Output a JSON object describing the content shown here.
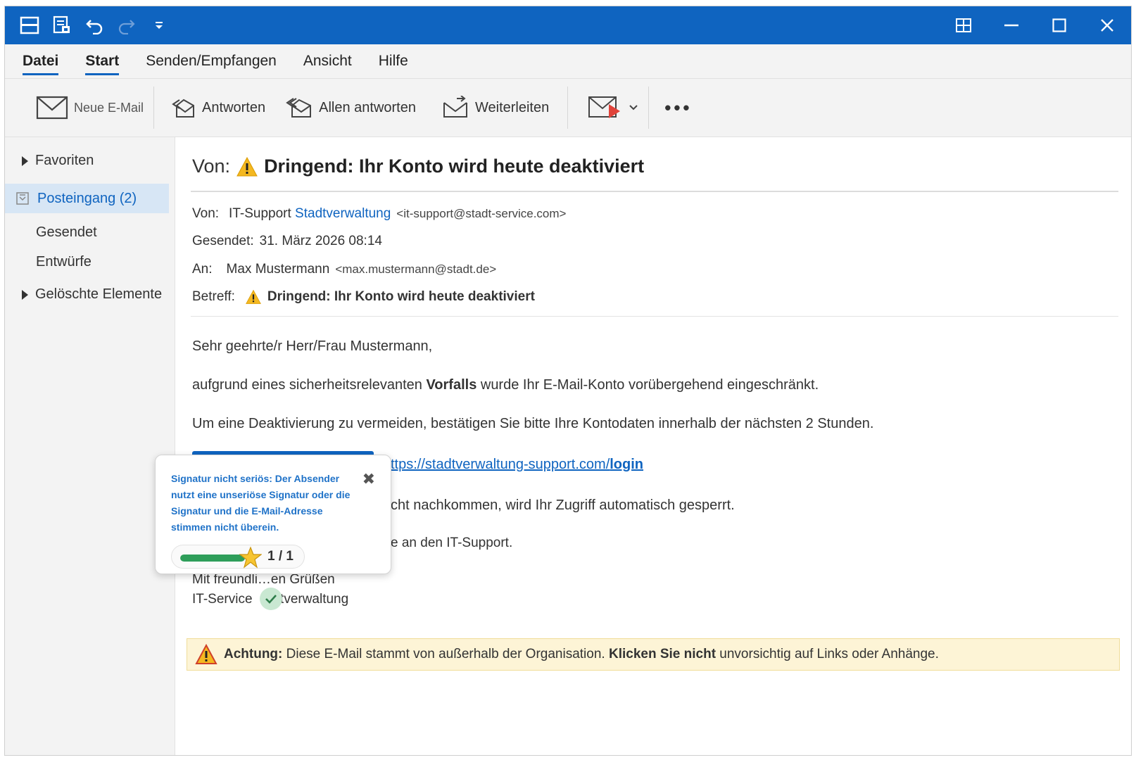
{
  "menu": {
    "items": [
      {
        "label": "Datei",
        "active": true,
        "bold": true
      },
      {
        "label": "Start",
        "active": true,
        "bold": true
      },
      {
        "label": "Senden/Empfangen",
        "active": false,
        "bold": false
      },
      {
        "label": "Ansicht",
        "active": false,
        "bold": false
      },
      {
        "label": "Hilfe",
        "active": false,
        "bold": false
      }
    ]
  },
  "ribbon": {
    "new_mail": "Neue E-Mail",
    "reply": "Antworten",
    "reply_all": "Allen antworten",
    "forward": "Weiterleiten",
    "more": "•••"
  },
  "sidebar": {
    "favorites": "Favoriten",
    "inbox": "Posteingang (2)",
    "sent": "Gesendet",
    "drafts": "Entwürfe",
    "deleted": "Gelöschte Elemente"
  },
  "email": {
    "heading_prefix": "Von:",
    "heading_subject": "Dringend: Ihr Konto wird heute deaktiviert",
    "from_label": "Von:",
    "from_name_part1": "IT-Support",
    "from_name_part2": "Stadtverwaltung",
    "from_address": "<it-support@stadt-service.com>",
    "sent_label": "Gesendet:",
    "sent_value": "31. März 2026 08:14",
    "to_label": "An:",
    "to_name": "Max Mustermann",
    "to_address": "<max.mustermann@stadt.de>",
    "subject_label": "Betreff:",
    "subject_value": "Dringend: Ihr Konto wird heute deaktiviert",
    "greeting": "Sehr geehrte/r Herr/Frau Mustermann,",
    "p1_before": "aufgrund eines sicherheitsrelevanten ",
    "p1_bold": "Vorfalls",
    "p1_after": " wurde Ihr E-Mail-Konto vorübergehend eingeschränkt.",
    "p2": "Um eine Deaktivierung zu vermeiden, bestätigen Sie bitte Ihre Kontodaten innerhalb der nächsten 2 Stunden.",
    "link_prefix": "ttps://stadtverwaltung-support.com/",
    "link_bold": "login",
    "p3": "cht nachkommen, wird Ihr Zugriff automatisch gesperrt.",
    "p4": "e an den IT-Support.",
    "closing": "Mit freundli…en Grüßen",
    "sig_part1": "IT-Service ",
    "sig_part2": "ltverwaltung"
  },
  "warning": {
    "label": "Achtung:",
    "text1": " Diese E-Mail stammt von außerhalb der Organisation. ",
    "bold": "Klicken Sie nicht",
    "text2": " unvorsichtig auf Links oder Anhänge."
  },
  "popover": {
    "text": "Signatur nicht seriös: Der Absender nutzt eine unseriöse Signatur oder die Signatur und die E-Mail-Adresse stimmen nicht überein.",
    "progress_fraction": 1.0,
    "count": "1 / 1"
  },
  "colors": {
    "accent": "#0f64c0",
    "warning_bg": "#fdf4d6",
    "progress": "#2e9e5a"
  },
  "icons": {
    "save": "save-icon",
    "undo": "undo-icon",
    "redo": "redo-icon",
    "warning": "warning-icon",
    "star": "star-icon",
    "close": "close-icon",
    "check": "check-icon"
  }
}
